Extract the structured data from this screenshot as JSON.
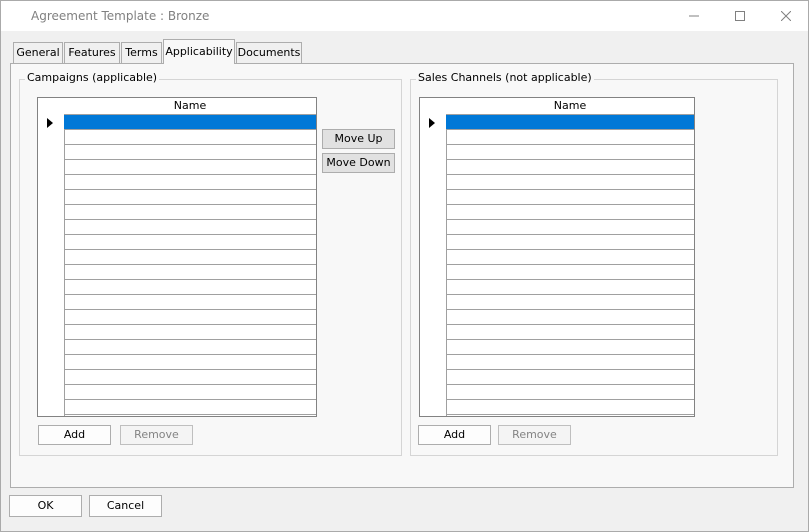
{
  "window": {
    "title": "Agreement Template : Bronze"
  },
  "tabs": [
    {
      "label": "General"
    },
    {
      "label": "Features"
    },
    {
      "label": "Terms"
    },
    {
      "label": "Applicability"
    },
    {
      "label": "Documents"
    }
  ],
  "campaigns": {
    "legend": "Campaigns (applicable)",
    "column": "Name",
    "add_label": "Add",
    "remove_label": "Remove"
  },
  "move": {
    "up_label": "Move Up",
    "down_label": "Move Down"
  },
  "sales_channels": {
    "legend": "Sales Channels (not applicable)",
    "column": "Name",
    "add_label": "Add",
    "remove_label": "Remove"
  },
  "footer": {
    "ok_label": "OK",
    "cancel_label": "Cancel"
  },
  "colors": {
    "selection": "#0078d7",
    "grid_line": "#a0a0a0"
  }
}
